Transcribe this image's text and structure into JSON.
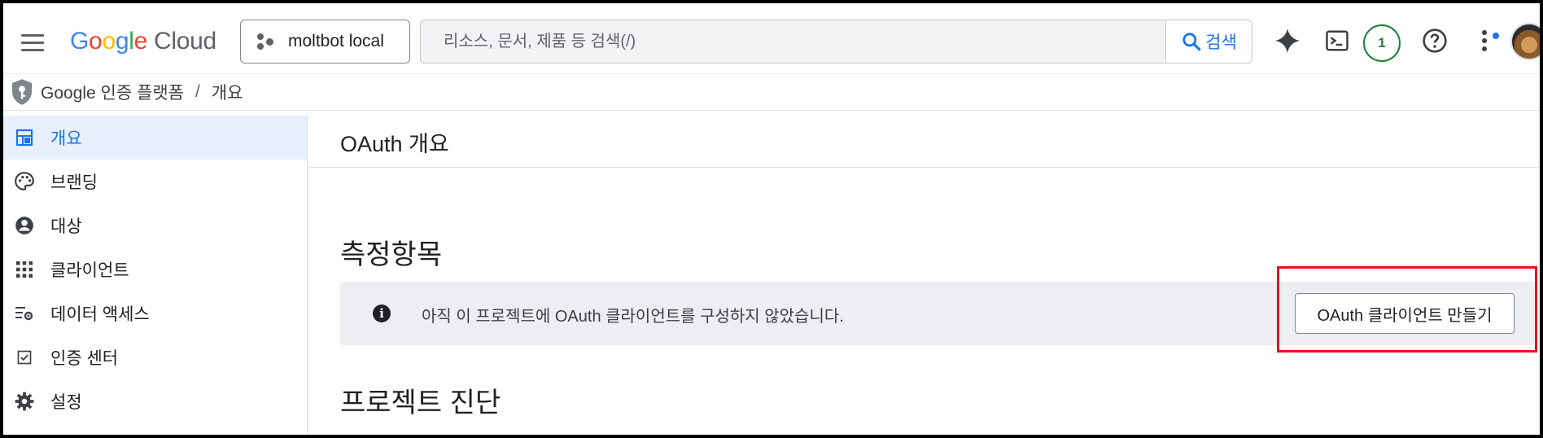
{
  "header": {
    "logo_google": "Google",
    "logo_cloud": "Cloud",
    "project_name": "moltbot local",
    "search_placeholder": "리소스, 문서, 제품 등 검색(/)",
    "search_button": "검색",
    "notification_count": "1",
    "icons": [
      "menu-icon",
      "gemini-sparkle-icon",
      "cloud-shell-icon",
      "help-icon",
      "more-vert-icon"
    ]
  },
  "breadcrumb": {
    "product": "Google 인증 플랫폼",
    "separator": "/",
    "current": "개요"
  },
  "sidebar": {
    "items": [
      {
        "label": "개요",
        "icon": "dashboard-icon",
        "active": true
      },
      {
        "label": "브랜딩",
        "icon": "palette-icon",
        "active": false
      },
      {
        "label": "대상",
        "icon": "account-circle-icon",
        "active": false
      },
      {
        "label": "클라이언트",
        "icon": "apps-grid-icon",
        "active": false
      },
      {
        "label": "데이터 액세스",
        "icon": "data-access-icon",
        "active": false
      },
      {
        "label": "인증 센터",
        "icon": "verified-checkbox-icon",
        "active": false
      },
      {
        "label": "설정",
        "icon": "gear-icon",
        "active": false
      }
    ]
  },
  "main": {
    "title": "OAuth 개요",
    "metrics_heading": "측정항목",
    "banner_message": "아직 이 프로젝트에 OAuth 클라이언트를 구성하지 않았습니다.",
    "create_button": "OAuth 클라이언트 만들기",
    "diagnostics_heading": "프로젝트 진단"
  },
  "colors": {
    "accent": "#1a73e8",
    "active_nav_bg": "#e8f0fe",
    "banner_bg": "#eceef2",
    "highlight": "#e0151e",
    "badge": "#188038"
  }
}
